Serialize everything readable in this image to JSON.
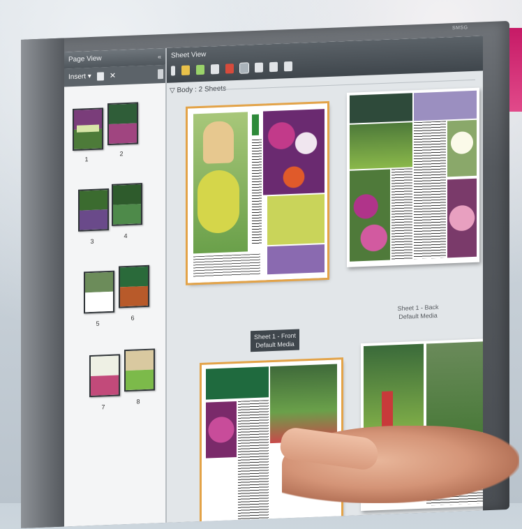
{
  "page_view": {
    "title": "Page View",
    "collapse": "«",
    "insert_label": "Insert",
    "thumbnails": [
      {
        "num": "1"
      },
      {
        "num": "2"
      },
      {
        "num": "3"
      },
      {
        "num": "4"
      },
      {
        "num": "5"
      },
      {
        "num": "6"
      },
      {
        "num": "7"
      },
      {
        "num": "8"
      }
    ]
  },
  "sheet_view": {
    "title": "Sheet View",
    "group_label": "Body : 2 Sheets",
    "sheets": [
      {
        "caption_line1": "Sheet 1 - Front",
        "caption_line2": "Default Media"
      },
      {
        "caption_line1": "Sheet 1 - Back",
        "caption_line2": "Default Media"
      }
    ]
  },
  "monitor_brand": "SMSG"
}
